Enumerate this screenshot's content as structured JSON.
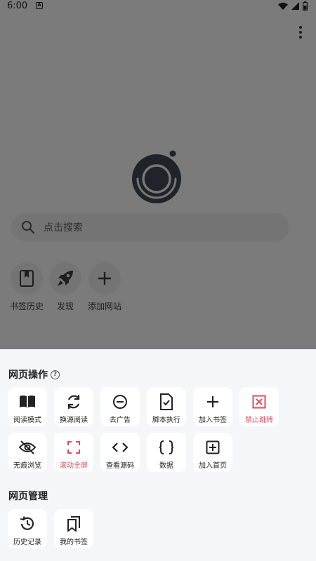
{
  "status_bar": {
    "time": "6:00"
  },
  "search": {
    "placeholder": "点击搜索"
  },
  "shortcuts": [
    {
      "label": "书签历史",
      "icon": "book-icon"
    },
    {
      "label": "发现",
      "icon": "rocket-icon"
    },
    {
      "label": "添加网站",
      "icon": "plus-icon"
    }
  ],
  "sheet": {
    "page_ops_title": "网页操作",
    "page_ops": [
      {
        "label": "阅读模式",
        "icon": "open-book-icon",
        "color": "#222222"
      },
      {
        "label": "换源阅读",
        "icon": "refresh-icon",
        "color": "#222222"
      },
      {
        "label": "去广告",
        "icon": "minus-circle-icon",
        "color": "#222222"
      },
      {
        "label": "脚本执行",
        "icon": "file-check-icon",
        "color": "#222222"
      },
      {
        "label": "加入书签",
        "icon": "plus-icon",
        "color": "#222222"
      },
      {
        "label": "禁止跳转",
        "icon": "close-box-icon",
        "color": "#e14a5d"
      },
      {
        "label": "无痕浏览",
        "icon": "eye-off-icon",
        "color": "#222222"
      },
      {
        "label": "滚动全屏",
        "icon": "fullscreen-icon",
        "color": "#e14a5d"
      },
      {
        "label": "查看源码",
        "icon": "code-icon",
        "color": "#222222"
      },
      {
        "label": "数据",
        "icon": "braces-icon",
        "color": "#222222"
      },
      {
        "label": "加入首页",
        "icon": "add-box-icon",
        "color": "#222222"
      }
    ],
    "page_mgmt_title": "网页管理",
    "page_mgmt": [
      {
        "label": "历史记录",
        "icon": "history-icon",
        "color": "#222222"
      },
      {
        "label": "我的书签",
        "icon": "bookmarks-icon",
        "color": "#222222"
      }
    ]
  }
}
